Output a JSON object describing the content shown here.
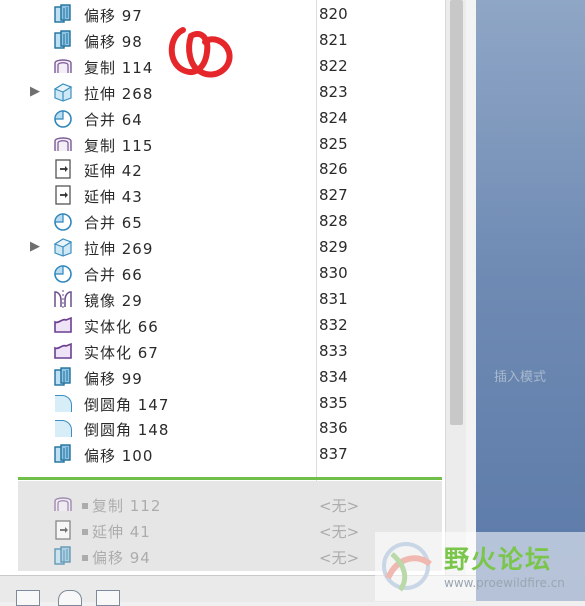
{
  "model_tree": {
    "rows": [
      {
        "name": "偏移 97",
        "num": "820",
        "icon": "offset-icon",
        "expandable": false
      },
      {
        "name": "偏移 98",
        "num": "821",
        "icon": "offset-icon",
        "expandable": false
      },
      {
        "name": "复制 114",
        "num": "822",
        "icon": "copy-surface-icon",
        "expandable": false
      },
      {
        "name": "拉伸 268",
        "num": "823",
        "icon": "extrude-icon",
        "expandable": true
      },
      {
        "name": "合并 64",
        "num": "824",
        "icon": "merge-icon",
        "expandable": false
      },
      {
        "name": "复制 115",
        "num": "825",
        "icon": "copy-surface-icon",
        "expandable": false
      },
      {
        "name": "延伸 42",
        "num": "826",
        "icon": "extend-icon",
        "expandable": false
      },
      {
        "name": "延伸 43",
        "num": "827",
        "icon": "extend-icon",
        "expandable": false
      },
      {
        "name": "合并 65",
        "num": "828",
        "icon": "merge-icon",
        "expandable": false
      },
      {
        "name": "拉伸 269",
        "num": "829",
        "icon": "extrude-icon",
        "expandable": true
      },
      {
        "name": "合并 66",
        "num": "830",
        "icon": "merge-icon",
        "expandable": false
      },
      {
        "name": "镜像 29",
        "num": "831",
        "icon": "mirror-icon",
        "expandable": false
      },
      {
        "name": "实体化 66",
        "num": "832",
        "icon": "solidify-icon",
        "expandable": false
      },
      {
        "name": "实体化 67",
        "num": "833",
        "icon": "solidify-icon",
        "expandable": false
      },
      {
        "name": "偏移 99",
        "num": "834",
        "icon": "offset-icon",
        "expandable": false
      },
      {
        "name": "倒圆角 147",
        "num": "835",
        "icon": "round-icon",
        "expandable": false
      },
      {
        "name": "倒圆角 148",
        "num": "836",
        "icon": "round-icon",
        "expandable": false
      },
      {
        "name": "偏移 100",
        "num": "837",
        "icon": "offset-icon",
        "expandable": false
      }
    ],
    "suppressed_rows": [
      {
        "name": "复制 112",
        "num": "<无>",
        "icon": "copy-surface-icon"
      },
      {
        "name": "延伸 41",
        "num": "<无>",
        "icon": "extend-icon"
      },
      {
        "name": "偏移 94",
        "num": "<无>",
        "icon": "offset-icon"
      }
    ]
  },
  "graphics_area": {
    "text": "插入模式"
  },
  "watermark": {
    "title": "野火论坛",
    "url": "www.proewildfire.cn"
  },
  "colors": {
    "accent_line": "#6fbf4a",
    "graphics_bg": "#6f8bb4",
    "annotation": "#e5262a"
  }
}
